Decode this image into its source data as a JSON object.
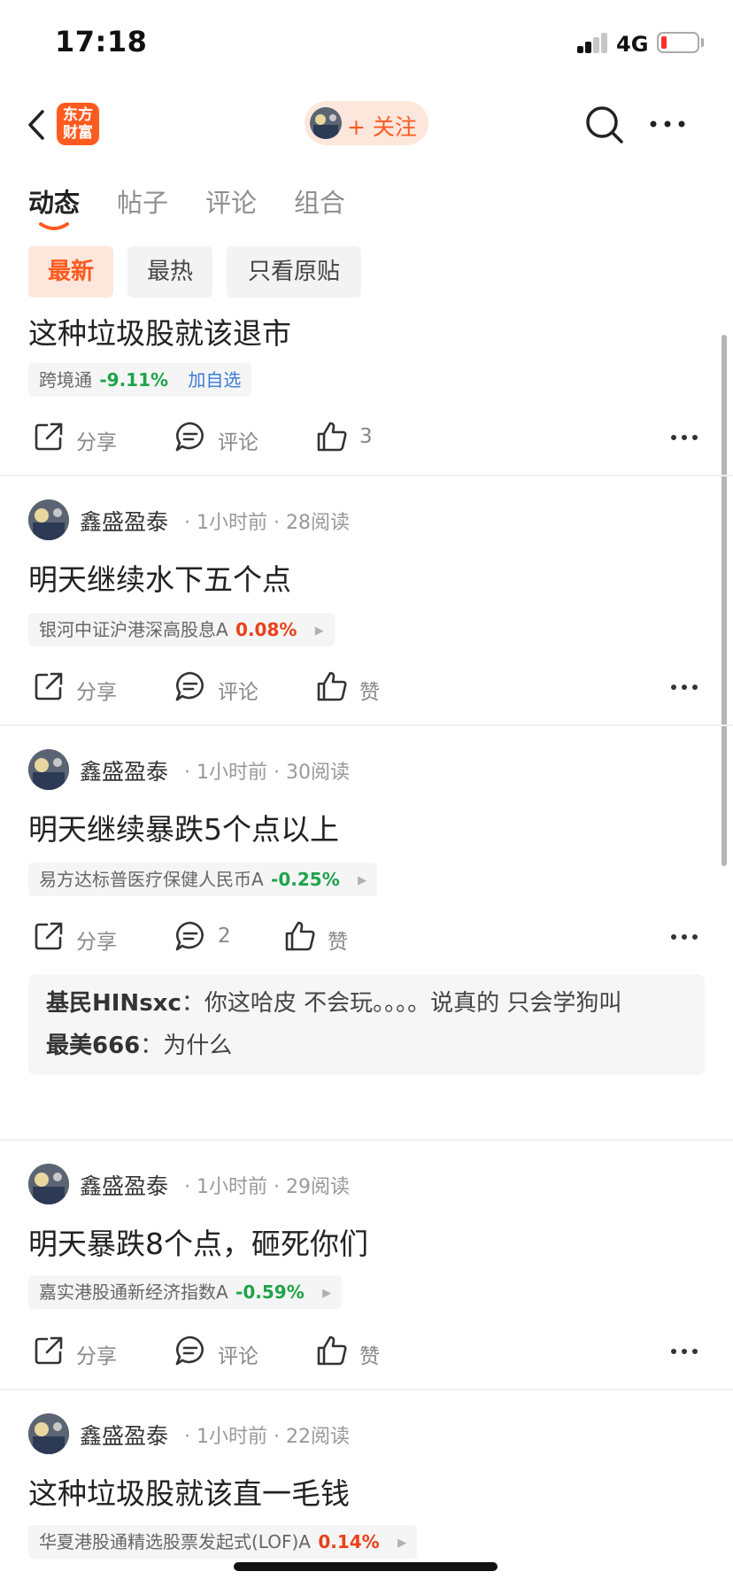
{
  "status_bar": {
    "time": "17:18",
    "network": "4G"
  },
  "nav": {
    "logo_text": "东方财富",
    "follow_label": "+ 关注"
  },
  "tabs": [
    {
      "label": "动态",
      "active": true
    },
    {
      "label": "帖子",
      "active": false
    },
    {
      "label": "评论",
      "active": false
    },
    {
      "label": "组合",
      "active": false
    }
  ],
  "filters": [
    {
      "label": "最新",
      "active": true
    },
    {
      "label": "最热",
      "active": false
    },
    {
      "label": "只看原贴",
      "active": false
    }
  ],
  "colors": {
    "accent": "#ff5a1f",
    "up": "#e8411a",
    "down": "#1fa34a",
    "link": "#3a7bd5"
  },
  "posts": [
    {
      "title": "这种垃圾股就该退市",
      "fund": {
        "name": "跨境通",
        "change": "-9.11%",
        "direction": "down",
        "action": "加自选"
      },
      "actions": {
        "share": "分享",
        "comment": "评论",
        "like": "3"
      }
    },
    {
      "author": "鑫盛盈泰",
      "time": "1小时前",
      "reads": "28阅读",
      "title": "明天继续水下五个点",
      "fund": {
        "name": "银河中证沪港深高股息A",
        "change": "0.08%",
        "direction": "up"
      },
      "actions": {
        "share": "分享",
        "comment": "评论",
        "like": "赞"
      }
    },
    {
      "author": "鑫盛盈泰",
      "time": "1小时前",
      "reads": "30阅读",
      "title": "明天继续暴跌5个点以上",
      "fund": {
        "name": "易方达标普医疗保健人民币A",
        "change": "-0.25%",
        "direction": "down"
      },
      "actions": {
        "share": "分享",
        "comment": "2",
        "like": "赞"
      },
      "comments": [
        {
          "user": "基民HINsxc",
          "text": "你这哈皮 不会玩。。。。说真的 只会学狗叫"
        },
        {
          "user": "最美666",
          "text": "为什么"
        }
      ]
    },
    {
      "author": "鑫盛盈泰",
      "time": "1小时前",
      "reads": "29阅读",
      "title": "明天暴跌8个点，砸死你们",
      "fund": {
        "name": "嘉实港股通新经济指数A",
        "change": "-0.59%",
        "direction": "down"
      },
      "actions": {
        "share": "分享",
        "comment": "评论",
        "like": "赞"
      }
    },
    {
      "author": "鑫盛盈泰",
      "time": "1小时前",
      "reads": "22阅读",
      "title": "这种垃圾股就该直一毛钱",
      "fund": {
        "name": "华夏港股通精选股票发起式(LOF)A",
        "change": "0.14%",
        "direction": "up"
      }
    }
  ],
  "separator": "：",
  "dot": "·"
}
